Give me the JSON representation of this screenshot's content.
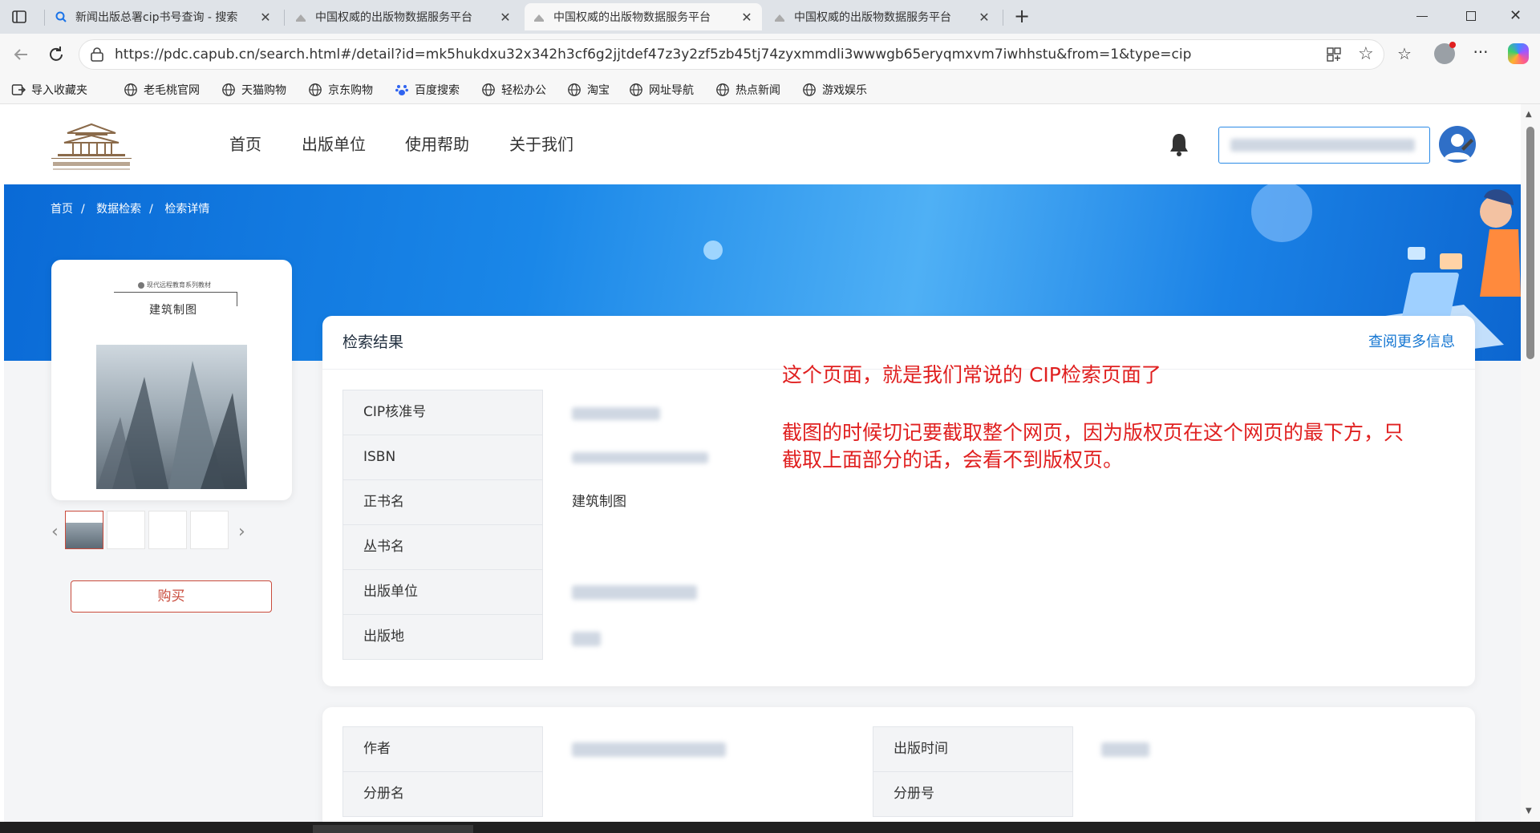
{
  "browser": {
    "tabs": [
      {
        "title": "新闻出版总署cip书号查询 - 搜索",
        "active": false
      },
      {
        "title": "中国权威的出版物数据服务平台",
        "active": false
      },
      {
        "title": "中国权威的出版物数据服务平台",
        "active": true
      },
      {
        "title": "中国权威的出版物数据服务平台",
        "active": false
      }
    ],
    "url": "https://pdc.capub.cn/search.html#/detail?id=mk5hukdxu32x342h3cf6g2jjtdef47z3y2zf5zb45tj74zyxmmdli3wwwgb65eryqmxvm7iwhhstu&from=1&type=cip",
    "bookmarks": [
      "导入收藏夹",
      "老毛桃官网",
      "天猫购物",
      "京东购物",
      "百度搜索",
      "轻松办公",
      "淘宝",
      "网址导航",
      "热点新闻",
      "游戏娱乐"
    ]
  },
  "site": {
    "nav": [
      "首页",
      "出版单位",
      "使用帮助",
      "关于我们"
    ],
    "breadcrumb": [
      "首页",
      "数据检索",
      "检索详情"
    ],
    "buy_label": "购买",
    "cover": {
      "series_line": "现代远程教育系列教材",
      "title": "建筑制图"
    }
  },
  "result": {
    "title": "检索结果",
    "more_link": "查阅更多信息",
    "rows": [
      {
        "label": "CIP核准号",
        "value": ""
      },
      {
        "label": "ISBN",
        "value": ""
      },
      {
        "label": "正书名",
        "value": "建筑制图"
      },
      {
        "label": "丛书名",
        "value": ""
      },
      {
        "label": "出版单位",
        "value": ""
      },
      {
        "label": "出版地",
        "value": ""
      }
    ],
    "note_line1": "这个页面，就是我们常说的 CIP检索页面了",
    "note_line2": "截图的时候切记要截取整个网页，因为版权页在这个网页的最下方，只",
    "note_line3": "截取上面部分的话，会看不到版权页。"
  },
  "details": {
    "left": [
      {
        "label": "作者",
        "value": ""
      },
      {
        "label": "分册名",
        "value": ""
      }
    ],
    "right": [
      {
        "label": "出版时间",
        "value": ""
      },
      {
        "label": "分册号",
        "value": ""
      }
    ]
  },
  "colors": {
    "accent": "#1677d2",
    "buy": "#c94b3c",
    "note": "#e02020"
  }
}
